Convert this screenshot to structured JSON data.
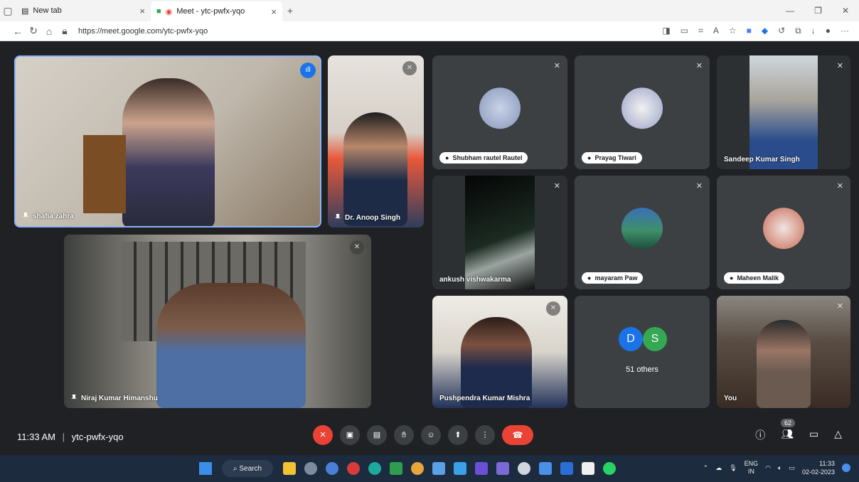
{
  "browser": {
    "tabs": [
      {
        "label": "New tab"
      },
      {
        "label": "Meet - ytc-pwfx-yqo"
      }
    ],
    "url": "https://meet.google.com/ytc-pwfx-yqo"
  },
  "tiles": {
    "shafia": "shafia zahra",
    "anoop": "Dr. Anoop Singh",
    "niraj": "Niraj Kumar Himanshu",
    "shubham": "Shubham rautel Rautel",
    "prayag": "Prayag Tiwari",
    "sandeep": "Sandeep Kumar Singh",
    "ankush": "ankush vishwakarma",
    "mayaram": "mayaram Paw",
    "maheen": "Maheen Malik",
    "pushpendra": "Pushpendra Kumar Mishra",
    "others_initial_1": "D",
    "others_initial_2": "S",
    "others_label": "51 others",
    "you": "You"
  },
  "bottom": {
    "time": "11:33 AM",
    "separator": "|",
    "code": "ytc-pwfx-yqo",
    "people_count": "62"
  },
  "taskbar": {
    "search": "Search",
    "lang1": "ENG",
    "lang2": "IN",
    "time": "11:33",
    "date": "02-02-2023"
  },
  "colors": {
    "accent": "#8ab4f8",
    "end_call": "#ea4335",
    "stage": "#202124"
  }
}
